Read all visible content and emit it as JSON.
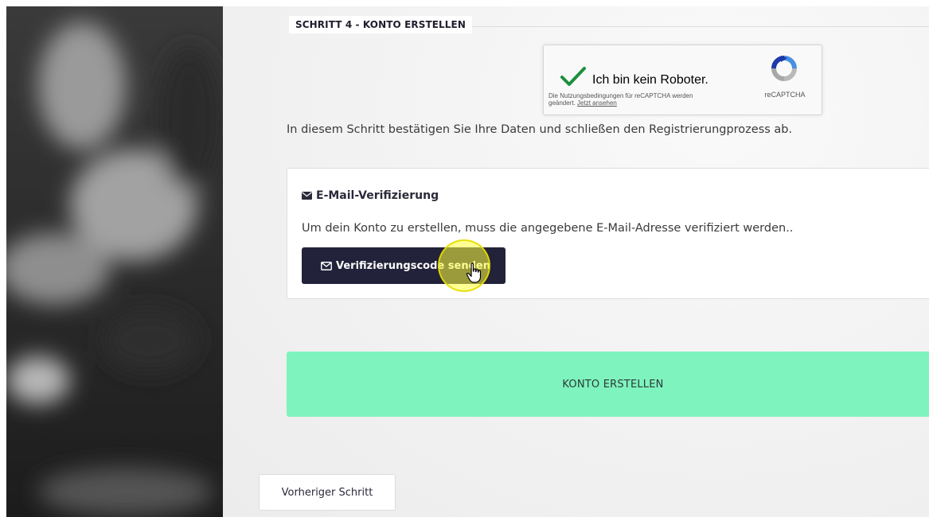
{
  "step": {
    "title": "SCHRITT 4 - KONTO ERSTELLEN",
    "intro": "In diesem Schritt bestätigen Sie Ihre Daten und schließen den Registrierungprozess ab."
  },
  "recaptcha": {
    "label": "Ich bin kein Roboter.",
    "terms_text": "Die Nutzungsbedingungen für reCAPTCHA werden geändert.",
    "terms_link": "Jetzt ansehen",
    "brand": "reCAPTCHA",
    "checked": true
  },
  "email_verification": {
    "heading": "E-Mail-Verifizierung",
    "heading_icon": "envelope-icon",
    "description": "Um dein Konto zu erstellen, muss die angegebene E-Mail-Adresse verifiziert werden..",
    "send_button_label": "Verifizierungscode senden",
    "send_button_icon": "envelope-outline-icon"
  },
  "actions": {
    "create_account_label": "KONTO ERSTELLEN",
    "previous_step_label": "Vorheriger Schritt"
  },
  "colors": {
    "create_button": "#7ff3be",
    "send_button": "#22223a",
    "check": "#1e8e3e",
    "cursor_highlight": "#ffff3c"
  }
}
